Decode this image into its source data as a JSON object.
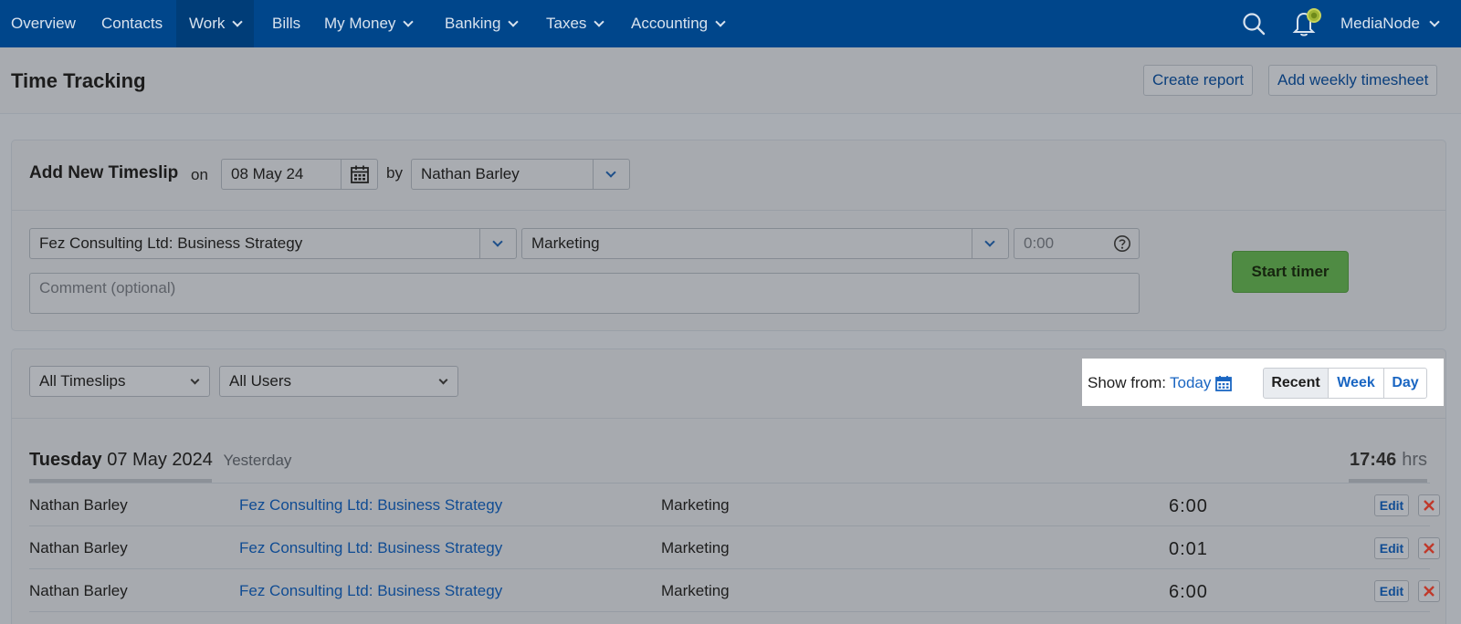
{
  "nav": {
    "items": [
      {
        "label": "Overview",
        "has_dropdown": false
      },
      {
        "label": "Contacts",
        "has_dropdown": false
      },
      {
        "label": "Work",
        "has_dropdown": true,
        "active": true
      },
      {
        "label": "Bills",
        "has_dropdown": false
      },
      {
        "label": "My Money",
        "has_dropdown": true
      },
      {
        "label": "Banking",
        "has_dropdown": true
      },
      {
        "label": "Taxes",
        "has_dropdown": true
      },
      {
        "label": "Accounting",
        "has_dropdown": true
      }
    ],
    "account_label": "MediaNode",
    "icons": [
      "search-icon",
      "bell-icon",
      "chevron-down-icon"
    ]
  },
  "header": {
    "title": "Time Tracking",
    "create_report": "Create report",
    "add_weekly": "Add weekly timesheet"
  },
  "new_timeslip": {
    "title": "Add New Timeslip",
    "on_label": "on",
    "date_value": "08 May 24",
    "by_label": "by",
    "user_value": "Nathan Barley",
    "project_value": "Fez Consulting Ltd: Business Strategy",
    "task_value": "Marketing",
    "hours_placeholder": "0:00",
    "comment_placeholder": "Comment (optional)",
    "start_timer": "Start timer"
  },
  "filters": {
    "timeslips_select": "All Timeslips",
    "users_select": "All Users",
    "show_from_label": "Show from:",
    "show_from_value": "Today",
    "view_tabs": [
      "Recent",
      "Week",
      "Day"
    ],
    "selected_tab": "Recent"
  },
  "day_group": {
    "weekday": "Tuesday",
    "date": "07 May 2024",
    "relative": "Yesterday",
    "total": "17:46",
    "total_unit": "hrs"
  },
  "entries": [
    {
      "user": "Nathan Barley",
      "project": "Fez Consulting Ltd: Business Strategy",
      "task": "Marketing",
      "hours": "6:00",
      "edit": "Edit"
    },
    {
      "user": "Nathan Barley",
      "project": "Fez Consulting Ltd: Business Strategy",
      "task": "Marketing",
      "hours": "0:01",
      "edit": "Edit"
    },
    {
      "user": "Nathan Barley",
      "project": "Fez Consulting Ltd: Business Strategy",
      "task": "Marketing",
      "hours": "6:00",
      "edit": "Edit"
    }
  ],
  "colors": {
    "nav_bg": "#00468b",
    "link": "#104c93",
    "start_button": "#4f8b43",
    "delete": "#c0392b",
    "overlay_highlight": "#ffffff"
  }
}
